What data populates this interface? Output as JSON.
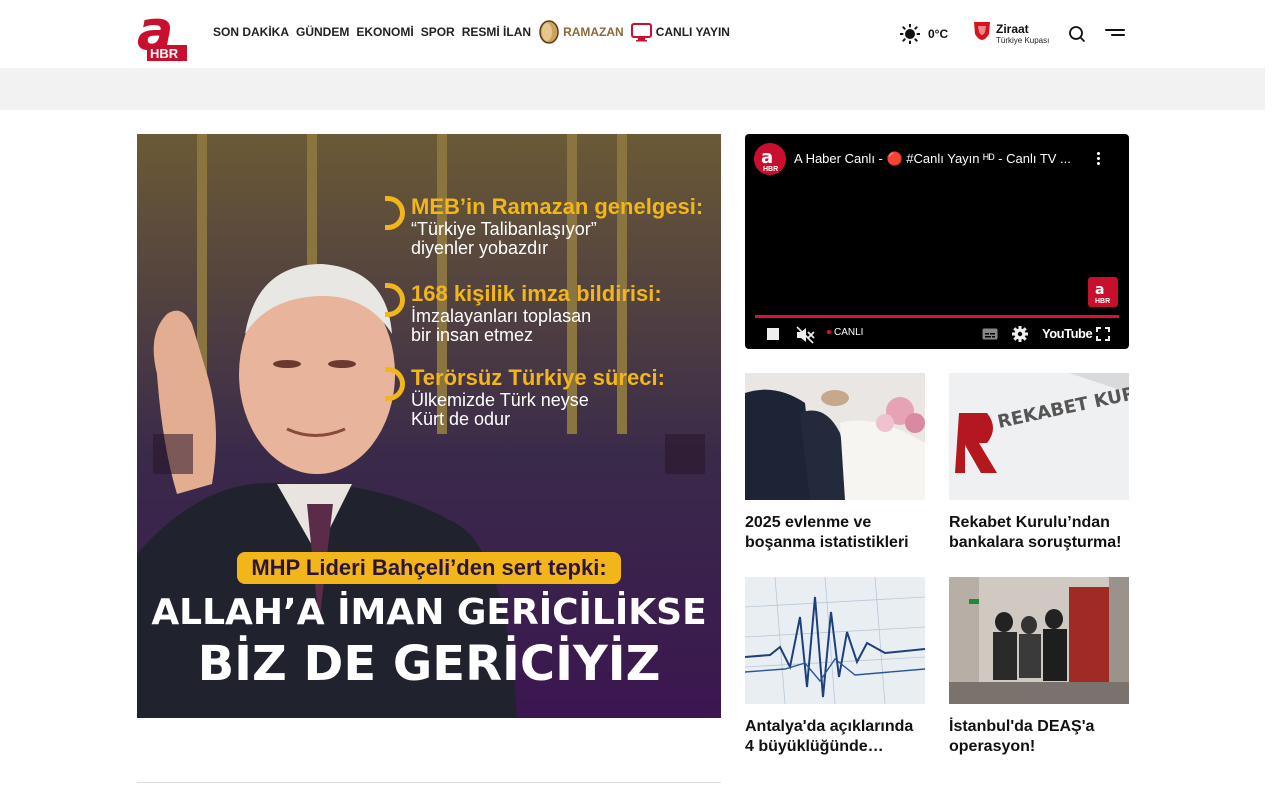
{
  "header": {
    "logo_text": "HBR",
    "nav": [
      {
        "label": "SON DAKİKA"
      },
      {
        "label": "GÜNDEM"
      },
      {
        "label": "EKONOMİ"
      },
      {
        "label": "SPOR"
      },
      {
        "label": "RESMİ İLAN"
      }
    ],
    "ramazan_label": "RAMAZAN",
    "live_tv_label": "CANLI YAYIN",
    "weather_temp": "0°C",
    "sponsor": {
      "brand": "Ziraat",
      "sub": "Türkiye Kupası"
    }
  },
  "hero": {
    "points": [
      {
        "head": "MEB’in Ramazan genelgesi:",
        "lines": [
          "“Türkiye Talibanlaşıyor”",
          "diyenler yobazdır"
        ]
      },
      {
        "head": "168 kişilik imza bildirisi:",
        "lines": [
          "İmzalayanları toplasan",
          "bir insan etmez"
        ]
      },
      {
        "head": "Terörsüz Türkiye süreci:",
        "lines": [
          "Ülkemizde Türk neyse",
          "Kürt de odur"
        ]
      }
    ],
    "tag": "MHP Lideri Bahçeli’den sert tepki:",
    "big_line1": "ALLAH’A İMAN GERİCİLİKSE",
    "big_line2": "BİZ DE GERİCİYİZ"
  },
  "video": {
    "title": "A Haber Canlı - 🔴 #Canlı Yayın ᴴᴰ - Canlı TV ...",
    "channel_logo_text": "HBR",
    "live_label": "CANLI",
    "youtube_label": "YouTube"
  },
  "cards": [
    {
      "caption": "2025 evlenme ve boşanma istatistikleri"
    },
    {
      "caption": "Rekabet Kurulu’ndan bankalara soruşturma!"
    },
    {
      "caption": "Antalya'da açıklarında 4 büyüklüğünde…"
    },
    {
      "caption": "İstanbul'da DEAŞ'a operasyon!"
    }
  ],
  "thumb_texts": {
    "rekabet_sign": "REKABET KURUMU"
  },
  "colors": {
    "brand_red": "#c8102e",
    "accent_gold": "#f2b61a",
    "ramazan_brown": "#8a6a3c",
    "hero_purple": "#3b1650"
  }
}
